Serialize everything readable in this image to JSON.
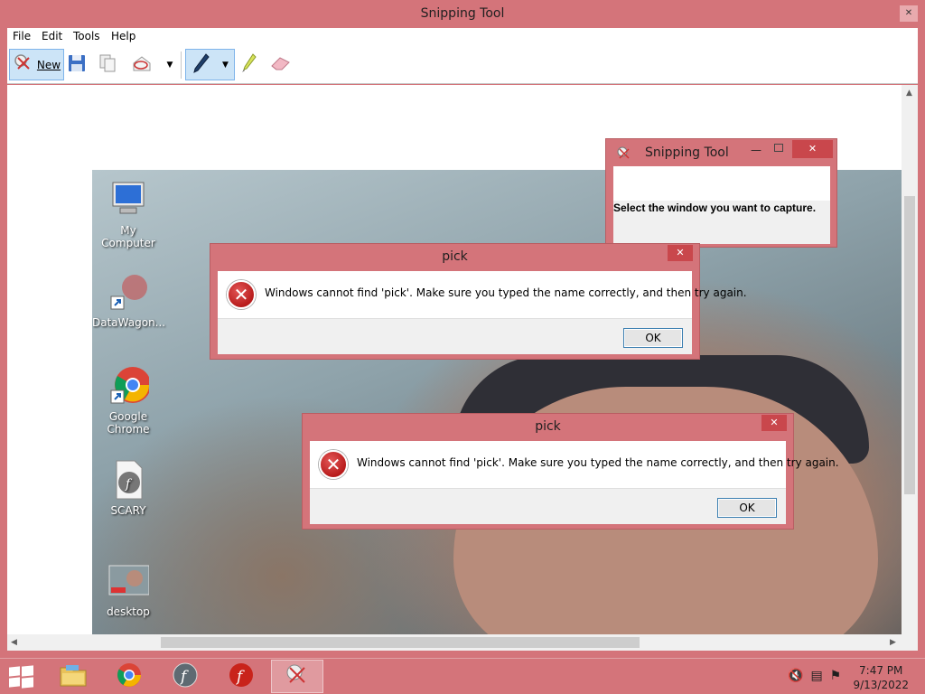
{
  "window": {
    "title": "Snipping Tool"
  },
  "menu": [
    "File",
    "Edit",
    "Tools",
    "Help"
  ],
  "toolbar": {
    "new_label": "New",
    "buttons": [
      "new-snip",
      "save-snip",
      "copy",
      "send-snip",
      "send-dropdown",
      "pen",
      "pen-dropdown",
      "highlighter",
      "eraser"
    ]
  },
  "desktop_icons": [
    {
      "label": "My Computer",
      "icon": "computer-icon"
    },
    {
      "label": "DataWagon...",
      "icon": "shortcut-icon"
    },
    {
      "label": "Google Chrome",
      "icon": "chrome-icon"
    },
    {
      "label": "SCARY",
      "icon": "flash-file-icon"
    },
    {
      "label": "desktop",
      "icon": "image-file-icon"
    }
  ],
  "dialogs": [
    {
      "title": "pick",
      "message": "Windows cannot find 'pick'. Make sure you typed the name correctly, and then try again.",
      "ok": "OK"
    },
    {
      "title": "pick",
      "message": "Windows cannot find 'pick'. Make sure you typed the name correctly, and then try again.",
      "ok": "OK"
    }
  ],
  "snip_window": {
    "title": "Snipping Tool",
    "message": "Select the window you want to capture."
  },
  "taskbar": {
    "apps": [
      "file-explorer-icon",
      "chrome-icon",
      "flash-player-icon",
      "flash-icon",
      "snipping-tool-icon"
    ],
    "active_app": "snipping-tool-icon",
    "tray_icons": [
      "volume-muted-icon",
      "network-icon",
      "action-center-icon"
    ],
    "time": "7:47 PM",
    "date": "9/13/2022"
  },
  "colors": {
    "accent": "#d4747a",
    "close": "#c9474c",
    "selected": "#cce4f7"
  }
}
